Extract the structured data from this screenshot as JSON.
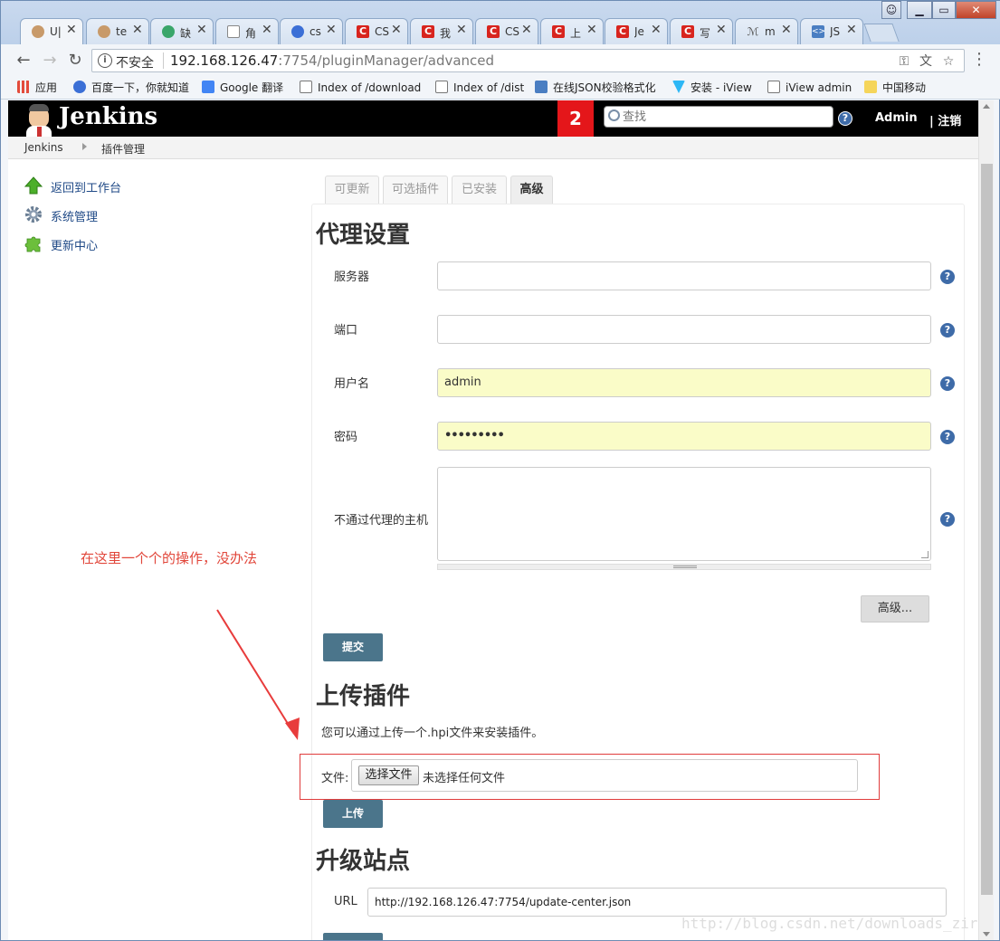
{
  "browser": {
    "tabs": [
      {
        "title": "U|",
        "icon": "jenkins-icon"
      },
      {
        "title": "te",
        "icon": "jenkins-icon"
      },
      {
        "title": "缺",
        "icon": "globe-icon"
      },
      {
        "title": "角",
        "icon": "page-icon"
      },
      {
        "title": "cs",
        "icon": "baidu-icon"
      },
      {
        "title": "CS",
        "icon": "csdn-icon"
      },
      {
        "title": "我",
        "icon": "csdn-icon"
      },
      {
        "title": "CS",
        "icon": "csdn-icon"
      },
      {
        "title": "上",
        "icon": "csdn-icon"
      },
      {
        "title": "Je",
        "icon": "csdn-icon"
      },
      {
        "title": "写",
        "icon": "csdn-icon"
      },
      {
        "title": "m",
        "icon": "m-icon"
      },
      {
        "title": "JS",
        "icon": "json-icon"
      }
    ],
    "tab_close_glyph": "✕",
    "insecure_label": "不安全",
    "url_host": "192.168.126.47",
    "url_rest": ":7754/pluginManager/advanced",
    "bookmarks": [
      {
        "label": "应用",
        "icon": "apps-grid-icon",
        "color": "#e34b3b"
      },
      {
        "label": "百度一下，你就知道",
        "icon": "baidu-icon",
        "color": "#3b6fd6"
      },
      {
        "label": "Google 翻译",
        "icon": "google-translate-icon",
        "color": "#4285f4"
      },
      {
        "label": "Index of /download",
        "icon": "page-icon",
        "color": "#ffffff"
      },
      {
        "label": "Index of /dist",
        "icon": "page-icon",
        "color": "#ffffff"
      },
      {
        "label": "在线JSON校验格式化",
        "icon": "json-icon",
        "color": "#4a7ec2"
      },
      {
        "label": "安装 - iView",
        "icon": "iview-icon",
        "color": "#2db7f5"
      },
      {
        "label": "iView admin",
        "icon": "page-icon",
        "color": "#ffffff"
      },
      {
        "label": "中国移动",
        "icon": "folder-icon",
        "color": "#f5d55a"
      }
    ]
  },
  "jenkins": {
    "logo_text": "Jenkins",
    "notification_count": "2",
    "search_placeholder": "查找",
    "help_glyph": "?",
    "user": "Admin",
    "logout": "| 注销",
    "breadcrumbs": [
      "Jenkins",
      "插件管理"
    ],
    "sidebar": [
      {
        "label": "返回到工作台",
        "icon": "up-arrow-icon"
      },
      {
        "label": "系统管理",
        "icon": "gear-icon"
      },
      {
        "label": "更新中心",
        "icon": "puzzle-icon"
      }
    ],
    "annotation": "在这里一个个的操作，没办法",
    "tabs": [
      "可更新",
      "可选插件",
      "已安装",
      "高级"
    ],
    "active_tab": "高级",
    "proxy": {
      "heading": "代理设置",
      "server_label": "服务器",
      "server_value": "",
      "port_label": "端口",
      "port_value": "",
      "username_label": "用户名",
      "username_value": "admin",
      "password_label": "密码",
      "password_value": "•••••••••",
      "noproxy_label": "不通过代理的主机",
      "advanced_button": "高级...",
      "submit_button": "提交"
    },
    "upload": {
      "heading": "上传插件",
      "description": "您可以通过上传一个.hpi文件来安装插件。",
      "file_label": "文件:",
      "choose_button": "选择文件",
      "no_file_text": "未选择任何文件",
      "upload_button": "上传"
    },
    "update_site": {
      "heading": "升级站点",
      "url_label": "URL",
      "url_value": "http://192.168.126.47:7754/update-center.json"
    }
  },
  "watermark": "http://blog.csdn.net/downloads_zir"
}
